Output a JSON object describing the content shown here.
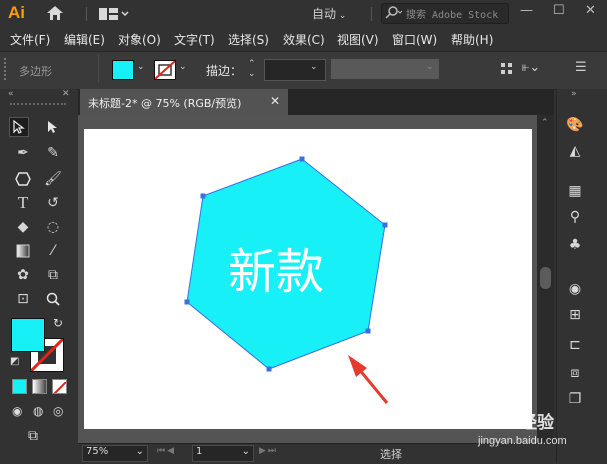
{
  "app": {
    "logo": "Ai",
    "workspace": "自动",
    "search_placeholder": "搜索 Adobe Stock",
    "window_controls": [
      "—",
      "☐",
      "✕"
    ]
  },
  "menu": [
    "文件(F)",
    "编辑(E)",
    "对象(O)",
    "文字(T)",
    "选择(S)",
    "效果(C)",
    "视图(V)",
    "窗口(W)",
    "帮助(H)"
  ],
  "control_bar": {
    "selection_label": "多边形",
    "fill_color": "#18f0f8",
    "stroke_label": "描边："
  },
  "document": {
    "tab_title": "未标题-2* @ 75% (RGB/预览)",
    "close": "✕",
    "artwork_text": "新款",
    "shape_color": "#18f0f8",
    "arrow_color": "#e53b2c"
  },
  "status": {
    "zoom": "75%",
    "page": "1",
    "tool": "选择"
  },
  "watermark": {
    "brand": "Baidu 经验",
    "url": "jingyan.baidu.com"
  }
}
